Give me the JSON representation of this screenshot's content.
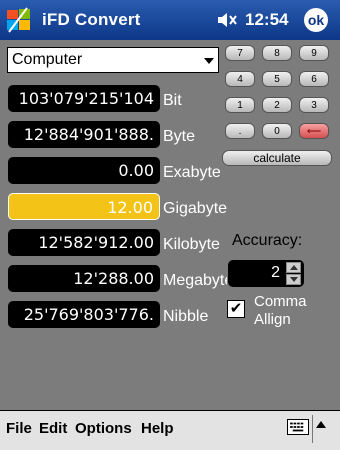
{
  "titlebar": {
    "app_title": "iFD Convert",
    "time": "12:54",
    "ok_label": "ok"
  },
  "selector": {
    "selected": "Computer"
  },
  "rows": [
    {
      "value": "103'079'215'104",
      "unit": "Bit"
    },
    {
      "value": "12'884'901'888.",
      "unit": "Byte"
    },
    {
      "value": "0.00",
      "unit": "Exabyte"
    },
    {
      "value": "12.00",
      "unit": "Gigabyte",
      "active": true
    },
    {
      "value": "12'582'912.00",
      "unit": "Kilobyte"
    },
    {
      "value": "12'288.00",
      "unit": "Megabyte"
    },
    {
      "value": "25'769'803'776.",
      "unit": "Nibble"
    }
  ],
  "keypad": {
    "keys": [
      "7",
      "8",
      "9",
      "4",
      "5",
      "6",
      "1",
      "2",
      "3",
      ".",
      "0",
      "⟵"
    ],
    "calculate": "calculate"
  },
  "accuracy": {
    "label": "Accuracy:",
    "value": "2"
  },
  "comma": {
    "label_line1": "Comma",
    "label_line2": "Allign",
    "checked": "✔"
  },
  "menubar": {
    "file": "File",
    "edit": "Edit",
    "options": "Options",
    "help": "Help"
  },
  "colors": {
    "titlebar": "#1a4a9e",
    "panel": "#7c7c7c",
    "active_field": "#f3c417",
    "backspace": "#d45050"
  }
}
